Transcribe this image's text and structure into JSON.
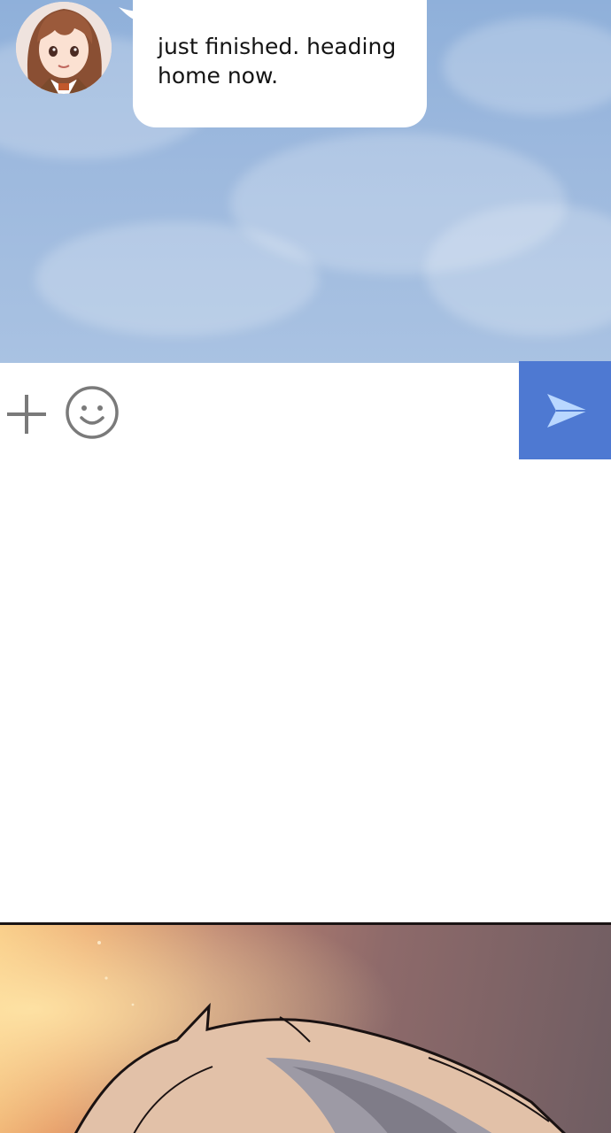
{
  "chat": {
    "message": {
      "text": "just finished. heading\nhome now.",
      "sender_avatar": "girl-avatar"
    }
  },
  "input_bar": {
    "attach_icon": "plus-icon",
    "emoji_icon": "smiley-face-icon",
    "send_icon": "paper-plane-send-icon"
  },
  "colors": {
    "sky": "#9db9de",
    "bubble": "#ffffff",
    "send_button": "#4e79d2",
    "send_arrow": "#b9d7ff",
    "icon_gray": "#7a7a7a",
    "comic_glow": "#f7c57e",
    "comic_shadow": "#6f5d62"
  }
}
